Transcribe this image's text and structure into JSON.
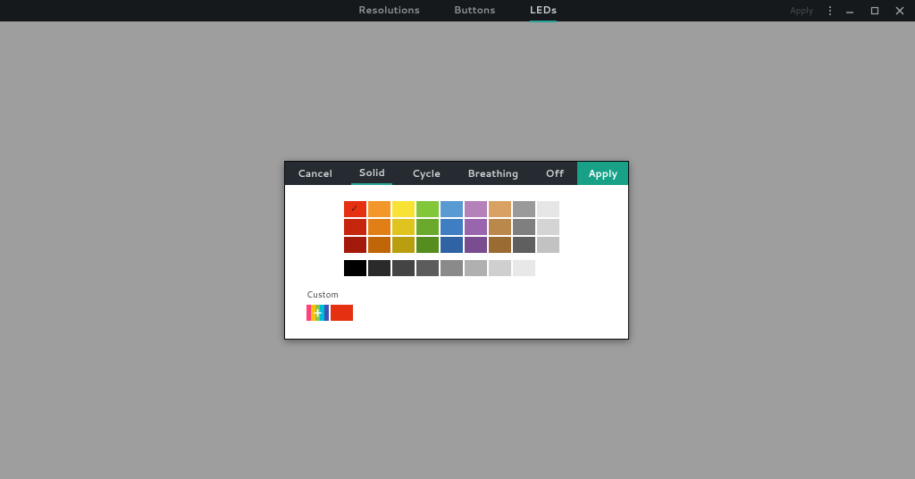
{
  "header": {
    "tabs": [
      "Resolutions",
      "Buttons",
      "LEDs"
    ],
    "active_tab": 2,
    "apply_label": "Apply"
  },
  "dialog": {
    "cancel_label": "Cancel",
    "tabs": [
      "Solid",
      "Cycle",
      "Breathing",
      "Off"
    ],
    "active_tab": 0,
    "apply_label": "Apply",
    "custom_label": "Custom",
    "custom_colors": [
      "#e53012"
    ],
    "selected_swatch": {
      "row": 0,
      "col": 0
    },
    "palette": [
      [
        "#e53012",
        "#f3972a",
        "#f7e235",
        "#82c63a",
        "#5a9ad3",
        "#b481bb",
        "#d9a264",
        "#9a9a9a",
        "#e6e6e6"
      ],
      [
        "#c7260e",
        "#e17f16",
        "#dfc31e",
        "#6aa92c",
        "#3f7ec2",
        "#9966ad",
        "#bb884b",
        "#7f7f7f",
        "#d4d4d4"
      ],
      [
        "#a31a0a",
        "#c16608",
        "#b99e10",
        "#568d1f",
        "#2f63a4",
        "#7a4c90",
        "#9a6c34",
        "#5f5f5f",
        "#c2c2c2"
      ]
    ],
    "shades": [
      "#000000",
      "#2a2a2a",
      "#444444",
      "#5c5c5c",
      "#8a8a8a",
      "#b0b0b0",
      "#cfcfcf",
      "#e8e8e8",
      "#ffffff"
    ]
  }
}
